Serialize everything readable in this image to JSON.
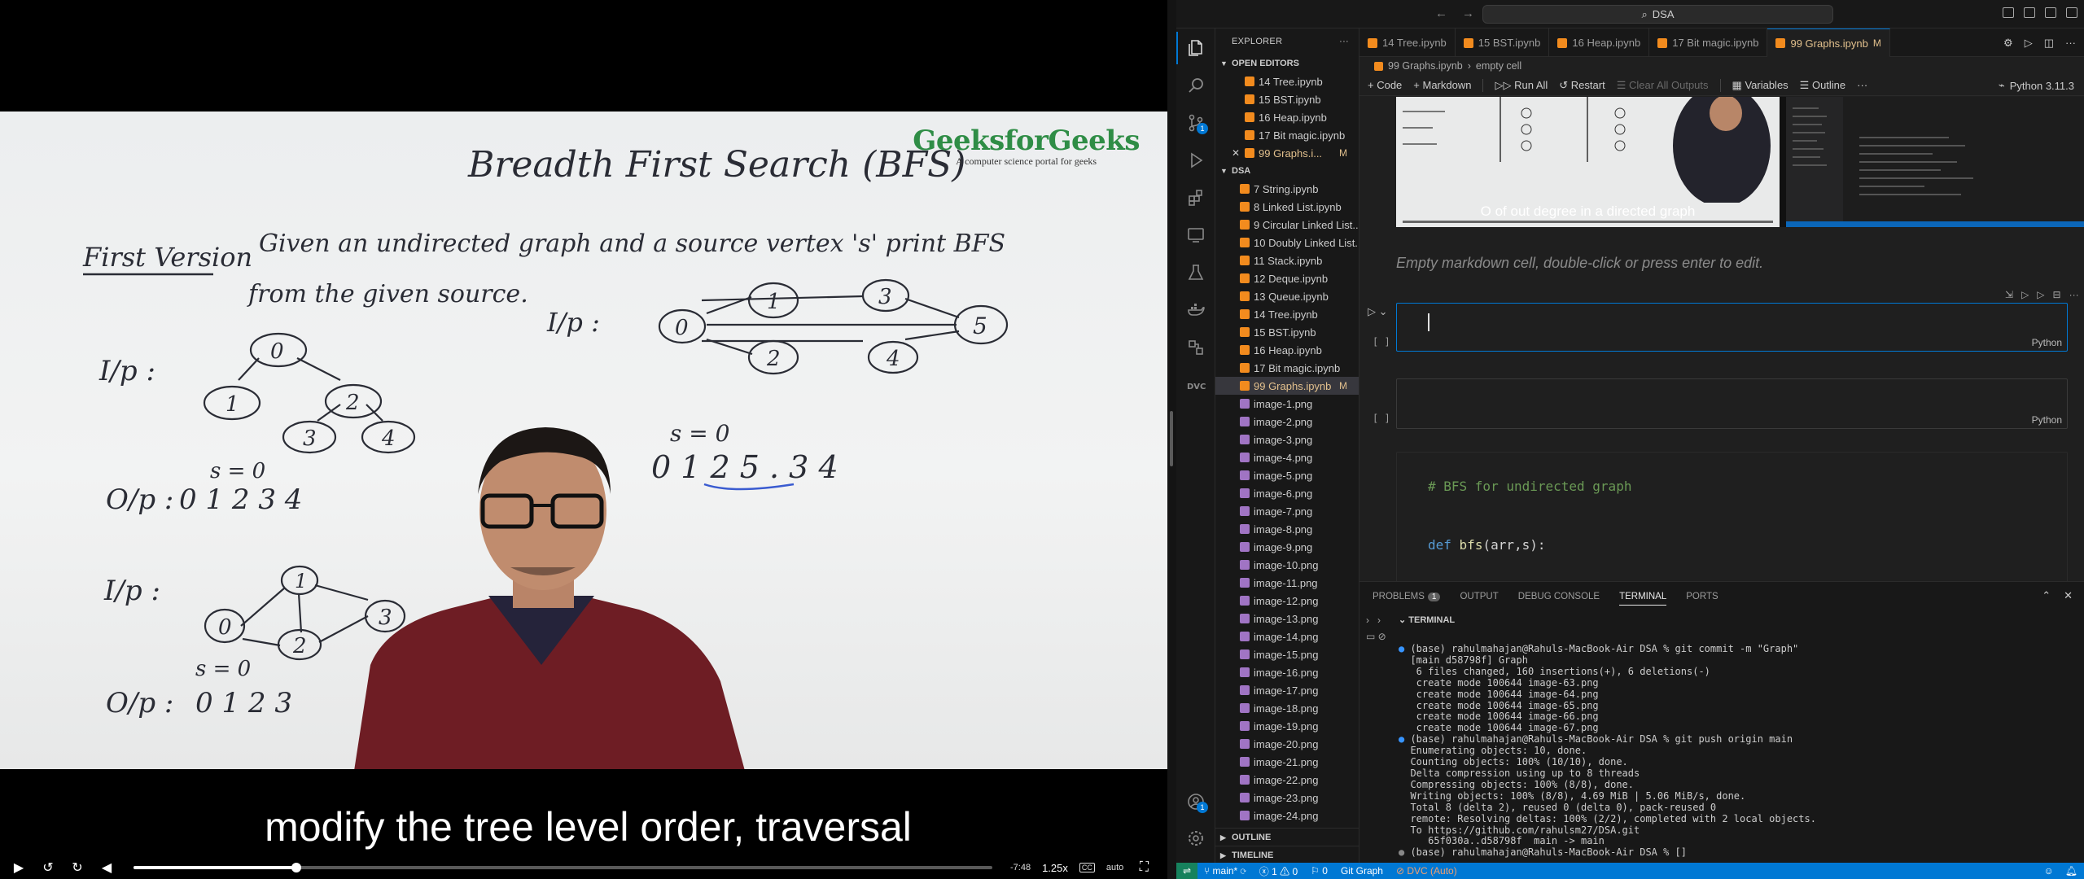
{
  "video": {
    "board": {
      "title": "Breadth First Search (BFS)",
      "first_version": "First Version",
      "problem_line1": "Given an undirected graph and a source vertex 's' print BFS",
      "problem_line2": "from the given source.",
      "ip1": "I/p :",
      "ip2": "I/p :",
      "ip3": "I/p :",
      "s_eq_0_a": "s = 0",
      "s_eq_0_b": "s = 0",
      "s_eq_0_c": "s = 0",
      "op1_label": "O/p :",
      "op1_values": "0  1  2  3  4",
      "op3_label": "O/p :",
      "op3_values": "0  1  2  3",
      "op2_values": "0   1 2 5 .  3   4",
      "tree_nodes": [
        "0",
        "1",
        "2",
        "3",
        "4"
      ],
      "graph2_nodes": [
        "0",
        "1",
        "3",
        "5",
        "2",
        "4"
      ],
      "graph3_nodes": [
        "0",
        "1",
        "2",
        "3"
      ]
    },
    "logo": {
      "name": "GeeksforGeeks",
      "tagline": "A computer science portal for geeks",
      "color": "#2f8d46"
    },
    "caption": "modify the tree level order, traversal",
    "controls": {
      "time_remaining": "-7:48",
      "speed": "1.25x",
      "cc": "CC",
      "quality": "auto",
      "progress": 0.19
    }
  },
  "vscode": {
    "titlebar": {
      "search": "DSA"
    },
    "activity": [
      {
        "name": "explorer",
        "badge": ""
      },
      {
        "name": "search",
        "badge": ""
      },
      {
        "name": "source-control",
        "badge": "1"
      },
      {
        "name": "run-debug",
        "badge": ""
      },
      {
        "name": "extensions",
        "badge": ""
      },
      {
        "name": "remote-explorer",
        "badge": ""
      },
      {
        "name": "testing",
        "badge": ""
      },
      {
        "name": "docker",
        "badge": ""
      },
      {
        "name": "jupyter",
        "badge": ""
      },
      {
        "name": "dvc",
        "badge": ""
      }
    ],
    "accounts_badge": "1",
    "explorer": {
      "title": "EXPLORER",
      "open_editors_label": "OPEN EDITORS",
      "open_editors": [
        {
          "label": "14 Tree.ipynb",
          "mod": ""
        },
        {
          "label": "15 BST.ipynb",
          "mod": ""
        },
        {
          "label": "16 Heap.ipynb",
          "mod": ""
        },
        {
          "label": "17 Bit magic.ipynb",
          "mod": ""
        },
        {
          "label": "99 Graphs.i...",
          "mod": "M"
        }
      ],
      "folder_label": "DSA",
      "files": [
        {
          "label": "7 String.ipynb",
          "kind": "nb",
          "mod": ""
        },
        {
          "label": "8 Linked List.ipynb",
          "kind": "nb",
          "mod": ""
        },
        {
          "label": "9 Circular Linked List....",
          "kind": "nb",
          "mod": ""
        },
        {
          "label": "10 Doubly Linked List....",
          "kind": "nb",
          "mod": ""
        },
        {
          "label": "11 Stack.ipynb",
          "kind": "nb",
          "mod": ""
        },
        {
          "label": "12 Deque.ipynb",
          "kind": "nb",
          "mod": ""
        },
        {
          "label": "13 Queue.ipynb",
          "kind": "nb",
          "mod": ""
        },
        {
          "label": "14 Tree.ipynb",
          "kind": "nb",
          "mod": ""
        },
        {
          "label": "15 BST.ipynb",
          "kind": "nb",
          "mod": ""
        },
        {
          "label": "16 Heap.ipynb",
          "kind": "nb",
          "mod": ""
        },
        {
          "label": "17 Bit magic.ipynb",
          "kind": "nb",
          "mod": ""
        },
        {
          "label": "99 Graphs.ipynb",
          "kind": "nb",
          "mod": "M"
        },
        {
          "label": "image-1.png",
          "kind": "img",
          "mod": ""
        },
        {
          "label": "image-2.png",
          "kind": "img",
          "mod": ""
        },
        {
          "label": "image-3.png",
          "kind": "img",
          "mod": ""
        },
        {
          "label": "image-4.png",
          "kind": "img",
          "mod": ""
        },
        {
          "label": "image-5.png",
          "kind": "img",
          "mod": ""
        },
        {
          "label": "image-6.png",
          "kind": "img",
          "mod": ""
        },
        {
          "label": "image-7.png",
          "kind": "img",
          "mod": ""
        },
        {
          "label": "image-8.png",
          "kind": "img",
          "mod": ""
        },
        {
          "label": "image-9.png",
          "kind": "img",
          "mod": ""
        },
        {
          "label": "image-10.png",
          "kind": "img",
          "mod": ""
        },
        {
          "label": "image-11.png",
          "kind": "img",
          "mod": ""
        },
        {
          "label": "image-12.png",
          "kind": "img",
          "mod": ""
        },
        {
          "label": "image-13.png",
          "kind": "img",
          "mod": ""
        },
        {
          "label": "image-14.png",
          "kind": "img",
          "mod": ""
        },
        {
          "label": "image-15.png",
          "kind": "img",
          "mod": ""
        },
        {
          "label": "image-16.png",
          "kind": "img",
          "mod": ""
        },
        {
          "label": "image-17.png",
          "kind": "img",
          "mod": ""
        },
        {
          "label": "image-18.png",
          "kind": "img",
          "mod": ""
        },
        {
          "label": "image-19.png",
          "kind": "img",
          "mod": ""
        },
        {
          "label": "image-20.png",
          "kind": "img",
          "mod": ""
        },
        {
          "label": "image-21.png",
          "kind": "img",
          "mod": ""
        },
        {
          "label": "image-22.png",
          "kind": "img",
          "mod": ""
        },
        {
          "label": "image-23.png",
          "kind": "img",
          "mod": ""
        },
        {
          "label": "image-24.png",
          "kind": "img",
          "mod": ""
        }
      ],
      "outline_label": "OUTLINE",
      "timeline_label": "TIMELINE"
    },
    "tabs": [
      {
        "label": "14 Tree.ipynb",
        "active": false,
        "mod": ""
      },
      {
        "label": "15 BST.ipynb",
        "active": false,
        "mod": ""
      },
      {
        "label": "16 Heap.ipynb",
        "active": false,
        "mod": ""
      },
      {
        "label": "17 Bit magic.ipynb",
        "active": false,
        "mod": ""
      },
      {
        "label": "99 Graphs.ipynb",
        "active": true,
        "mod": "M"
      }
    ],
    "breadcrumb": {
      "file": "99 Graphs.ipynb",
      "cell": "empty cell"
    },
    "toolbar": {
      "code": "+ Code",
      "markdown": "+ Markdown",
      "run_all": "Run All",
      "restart": "Restart",
      "clear_all": "Clear All Outputs",
      "variables": "Variables",
      "outline": "Outline",
      "more": "···",
      "kernel": "Python 3.11.3"
    },
    "output_image_caption": "O of out degree in a directed graph",
    "md_placeholder": "Empty markdown cell, double-click or press enter to edit.",
    "cells": [
      {
        "gutter": "[ ]",
        "lang": "Python"
      },
      {
        "gutter": "[ ]",
        "lang": "Python"
      }
    ],
    "code_cell": {
      "comment": "# BFS for undirected graph",
      "def_kw": "def",
      "fn_name": "bfs",
      "args": "(arr,s):"
    },
    "panel": {
      "tabs": [
        {
          "label": "PROBLEMS",
          "count": "1"
        },
        {
          "label": "OUTPUT",
          "count": ""
        },
        {
          "label": "DEBUG CONSOLE",
          "count": ""
        },
        {
          "label": "TERMINAL",
          "count": ""
        },
        {
          "label": "PORTS",
          "count": ""
        }
      ],
      "terminal_label": "TERMINAL",
      "terminal_lines": [
        {
          "mark": "dot",
          "text": "(base) rahulmahajan@Rahuls-MacBook-Air DSA % git commit -m \"Graph\""
        },
        {
          "mark": "",
          "text": "[main d58798f] Graph"
        },
        {
          "mark": "",
          "text": " 6 files changed, 160 insertions(+), 6 deletions(-)"
        },
        {
          "mark": "",
          "text": " create mode 100644 image-63.png"
        },
        {
          "mark": "",
          "text": " create mode 100644 image-64.png"
        },
        {
          "mark": "",
          "text": " create mode 100644 image-65.png"
        },
        {
          "mark": "",
          "text": " create mode 100644 image-66.png"
        },
        {
          "mark": "",
          "text": " create mode 100644 image-67.png"
        },
        {
          "mark": "dot",
          "text": "(base) rahulmahajan@Rahuls-MacBook-Air DSA % git push origin main"
        },
        {
          "mark": "",
          "text": "Enumerating objects: 10, done."
        },
        {
          "mark": "",
          "text": "Counting objects: 100% (10/10), done."
        },
        {
          "mark": "",
          "text": "Delta compression using up to 8 threads"
        },
        {
          "mark": "",
          "text": "Compressing objects: 100% (8/8), done."
        },
        {
          "mark": "",
          "text": "Writing objects: 100% (8/8), 4.69 MiB | 5.06 MiB/s, done."
        },
        {
          "mark": "",
          "text": "Total 8 (delta 2), reused 0 (delta 0), pack-reused 0"
        },
        {
          "mark": "",
          "text": "remote: Resolving deltas: 100% (2/2), completed with 2 local objects."
        },
        {
          "mark": "",
          "text": "To https://github.com/rahulsm27/DSA.git"
        },
        {
          "mark": "",
          "text": "   65f030a..d58798f  main -> main"
        },
        {
          "mark": "dotg",
          "text": "(base) rahulmahajan@Rahuls-MacBook-Air DSA % []"
        }
      ]
    },
    "statusbar": {
      "branch": "main*",
      "errors": "1",
      "warnings": "0",
      "ports": "0",
      "git_graph": "Git Graph",
      "dvc": "DVC (Auto)"
    }
  }
}
